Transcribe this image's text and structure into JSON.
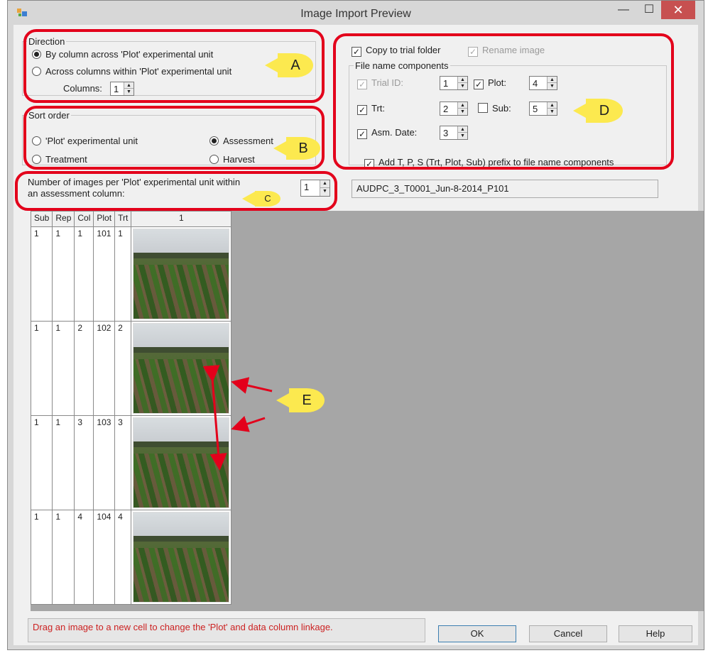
{
  "window": {
    "title": "Image Import Preview",
    "min_glyph": "—",
    "max_glyph": "☐",
    "close_glyph": "✕"
  },
  "direction": {
    "legend": "Direction",
    "option_by_column": "By column across 'Plot' experimental unit",
    "option_across_columns": "Across columns within 'Plot' experimental unit",
    "columns_label": "Columns:",
    "columns_value": "1",
    "selected": "By column across 'Plot' experimental unit"
  },
  "sort_order": {
    "legend": "Sort order",
    "options": [
      "'Plot' experimental unit",
      "Treatment",
      "Assessment",
      "Harvest"
    ],
    "selected": "Assessment"
  },
  "images_per_plot": {
    "label_line1": "Number of images per 'Plot' experimental unit within",
    "label_line2": "an assessment column:",
    "value": "1"
  },
  "file_options": {
    "copy_to_trial_folder": "Copy to trial folder",
    "rename_image": "Rename image",
    "components_legend": "File name components",
    "trial_id_label": "Trial ID:",
    "trial_id_value": "1",
    "plot_label": "Plot:",
    "plot_value": "4",
    "trt_label": "Trt:",
    "trt_value": "2",
    "sub_label": "Sub:",
    "sub_value": "5",
    "asm_date_label": "Asm. Date:",
    "asm_date_value": "3",
    "prefix_option": "Add T, P, S (Trt, Plot, Sub) prefix to file name components",
    "preview_filename": "AUDPC_3_T0001_Jun-8-2014_P101",
    "checked": {
      "copy": true,
      "rename": true,
      "trial_id": true,
      "plot": true,
      "trt": true,
      "sub": false,
      "asm_date": true,
      "prefix": true
    }
  },
  "callouts": {
    "a": "A",
    "b": "B",
    "c": "C",
    "d": "D",
    "e": "E"
  },
  "grid": {
    "headers": [
      "Sub",
      "Rep",
      "Col",
      "Plot",
      "Trt",
      "1"
    ],
    "rows": [
      {
        "sub": "1",
        "rep": "1",
        "col": "1",
        "plot": "101",
        "trt": "1"
      },
      {
        "sub": "1",
        "rep": "1",
        "col": "2",
        "plot": "102",
        "trt": "2"
      },
      {
        "sub": "1",
        "rep": "1",
        "col": "3",
        "plot": "103",
        "trt": "3"
      },
      {
        "sub": "1",
        "rep": "1",
        "col": "4",
        "plot": "104",
        "trt": "4"
      }
    ]
  },
  "status_text": "Drag an image to a new cell to change the 'Plot' and data column linkage.",
  "buttons": {
    "ok": "OK",
    "cancel": "Cancel",
    "help": "Help"
  },
  "colors": {
    "callout_ring": "#e3001b",
    "callout_badge": "#fce94f",
    "status_text": "#cc2222",
    "grid_background": "#a6a6a6"
  }
}
